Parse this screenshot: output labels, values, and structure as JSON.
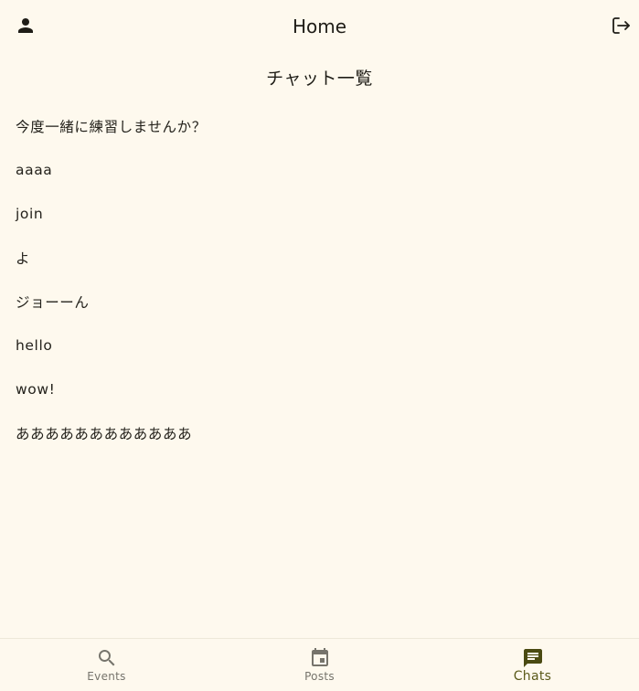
{
  "app_bar": {
    "title": "Home",
    "left_icon": "person-icon",
    "right_icon": "logout-icon"
  },
  "section_title": "チャット一覧",
  "chats": [
    {
      "title": "今度一緒に練習しませんか？"
    },
    {
      "title": "aaaa"
    },
    {
      "title": "join"
    },
    {
      "title": "よ"
    },
    {
      "title": "ジョーーん"
    },
    {
      "title": "hello"
    },
    {
      "title": "wow!"
    },
    {
      "title": "ああああああああああああ"
    }
  ],
  "bottom_nav": {
    "items": [
      {
        "label": "Events",
        "icon": "search-icon",
        "active": false
      },
      {
        "label": "Posts",
        "icon": "calendar-icon",
        "active": false
      },
      {
        "label": "Chats",
        "icon": "chat-icon",
        "active": true
      }
    ]
  },
  "colors": {
    "background": "#FEF9EE",
    "text": "#1f1d17",
    "nav_inactive": "#76746c",
    "nav_active": "#5a5a1a"
  }
}
